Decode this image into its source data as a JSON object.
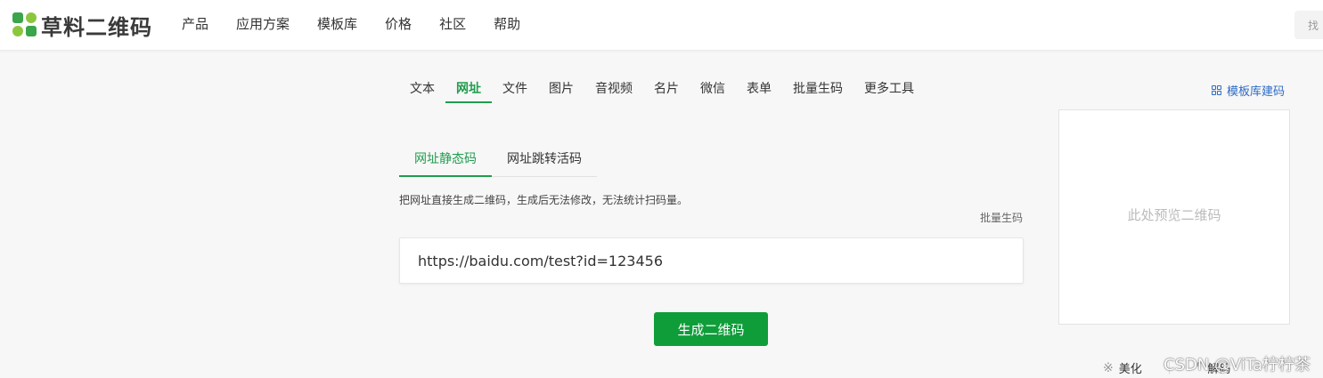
{
  "brand": {
    "name": "草料二维码"
  },
  "nav": {
    "items": [
      {
        "label": "产品"
      },
      {
        "label": "应用方案"
      },
      {
        "label": "模板库"
      },
      {
        "label": "价格"
      },
      {
        "label": "社区"
      },
      {
        "label": "帮助"
      }
    ],
    "search_text": "找"
  },
  "category_tabs": [
    {
      "label": "文本"
    },
    {
      "label": "网址",
      "active": true
    },
    {
      "label": "文件"
    },
    {
      "label": "图片"
    },
    {
      "label": "音视频"
    },
    {
      "label": "名片"
    },
    {
      "label": "微信"
    },
    {
      "label": "表单"
    },
    {
      "label": "批量生码"
    },
    {
      "label": "更多工具"
    }
  ],
  "template_link": {
    "label": "模板库建码",
    "icon": "grid-icon"
  },
  "sub_tabs": [
    {
      "label": "网址静态码",
      "active": true
    },
    {
      "label": "网址跳转活码"
    }
  ],
  "description": "把网址直接生成二维码，生成后无法修改，无法统计扫码量。",
  "batch_link": "批量生码",
  "url_input": {
    "value": "https://baidu.com/test?id=123456"
  },
  "generate_button": "生成二维码",
  "preview": {
    "placeholder": "此处预览二维码"
  },
  "tools": [
    {
      "label": "美化",
      "icon": "sparkle-icon"
    },
    {
      "label": "解码",
      "icon": "scan-icon"
    }
  ],
  "watermark": "CSDN @ViTa柠柠茶",
  "colors": {
    "primary": "#0f9d3a",
    "link": "#2e6bc6"
  }
}
